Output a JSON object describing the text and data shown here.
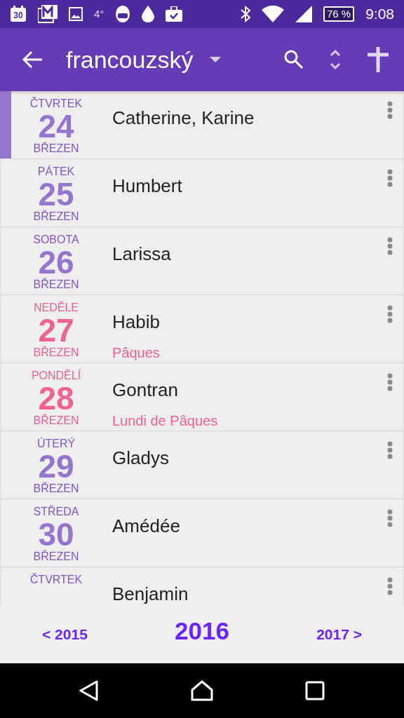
{
  "status_bar": {
    "calendar_date": "30",
    "temperature": "4°",
    "battery": "76 %",
    "time": "9:08"
  },
  "app_bar": {
    "title": "francouzský"
  },
  "rows": [
    {
      "weekday": "ČTVRTEK",
      "day": "24",
      "month": "BŘEZEN",
      "name": "Catherine, Karine",
      "holiday": false,
      "selected": true
    },
    {
      "weekday": "PÁTEK",
      "day": "25",
      "month": "BŘEZEN",
      "name": "Humbert",
      "holiday": false,
      "selected": false
    },
    {
      "weekday": "SOBOTA",
      "day": "26",
      "month": "BŘEZEN",
      "name": "Larissa",
      "holiday": false,
      "selected": false
    },
    {
      "weekday": "NEDĚLE",
      "day": "27",
      "month": "BŘEZEN",
      "name": "Habib",
      "feast": "Pâques",
      "holiday": true,
      "selected": false
    },
    {
      "weekday": "PONDĚLÍ",
      "day": "28",
      "month": "BŘEZEN",
      "name": "Gontran",
      "feast": "Lundi de Pâques",
      "holiday": true,
      "selected": false
    },
    {
      "weekday": "ÚTERÝ",
      "day": "29",
      "month": "BŘEZEN",
      "name": "Gladys",
      "holiday": false,
      "selected": false
    },
    {
      "weekday": "STŘEDA",
      "day": "30",
      "month": "BŘEZEN",
      "name": "Amédée",
      "holiday": false,
      "selected": false
    },
    {
      "weekday": "ČTVRTEK",
      "name": "Benjamin",
      "holiday": false,
      "selected": false
    }
  ],
  "year_bar": {
    "previous": "< 2015",
    "current": "2016",
    "next": "2017 >"
  }
}
